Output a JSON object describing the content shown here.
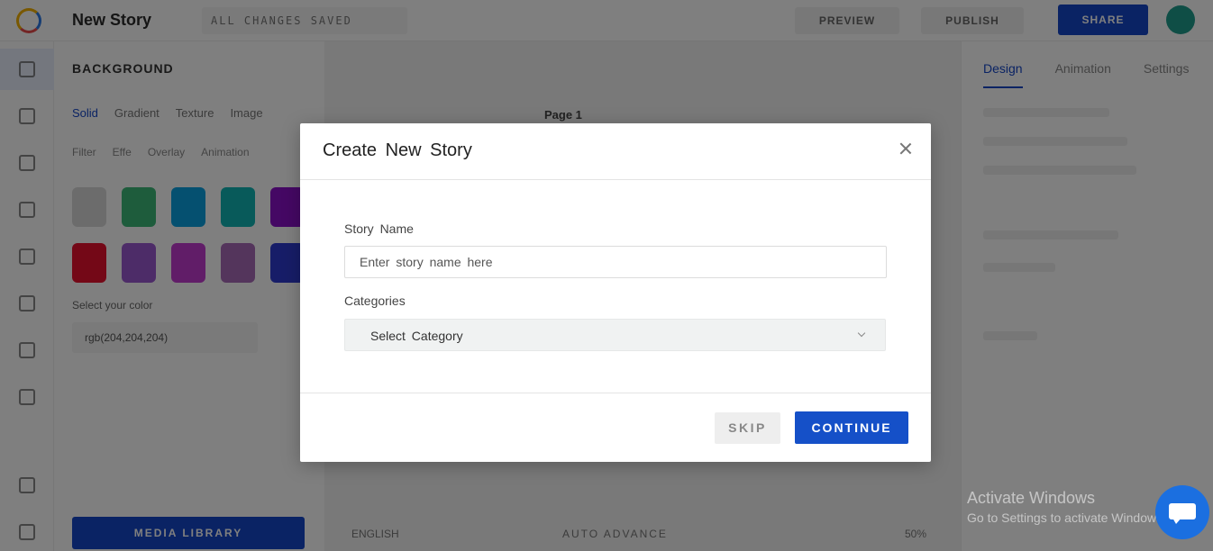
{
  "app": {
    "title": "New Story",
    "saved_status": "ALL CHANGES SAVED",
    "preview_label": "PREVIEW",
    "publish_label": "PUBLISH",
    "share_label": "SHARE"
  },
  "left_panel": {
    "title": "BACKGROUND",
    "tabs": [
      "Solid",
      "Gradient",
      "Texture",
      "Image"
    ],
    "sub_tabs": [
      "Filter",
      "Effe",
      "Overlay",
      "Animation"
    ],
    "swatch_colors": [
      "#d9d9d9",
      "#3cb878",
      "#0aa0e0",
      "#10b4b4",
      "#8a10c8",
      "#e8102e",
      "#9b59d0",
      "#c23ad0",
      "#a86ab8",
      "#2e3ad0"
    ],
    "select_color_label": "Select your color",
    "hex_value": "rgb(204,204,204)",
    "media_button_label": "MEDIA LIBRARY"
  },
  "canvas": {
    "page_label": "Page 1",
    "language": "ENGLISH",
    "autoadvance_label": "AUTO ADVANCE",
    "zoom": "50%"
  },
  "right_panel": {
    "tabs": [
      "Design",
      "Animation",
      "Settings"
    ]
  },
  "modal": {
    "title": "Create New Story",
    "story_name_label": "Story Name",
    "story_name_placeholder": "Enter story name here",
    "categories_label": "Categories",
    "category_selected": "Select Category",
    "skip_label": "SKIP",
    "continue_label": "CONTINUE"
  },
  "watermark": {
    "line1": "Activate Windows",
    "line2": "Go to Settings to activate Windows."
  },
  "colors": {
    "accent": "#1550c8",
    "overlay": "rgba(0,0,0,0.5)"
  }
}
